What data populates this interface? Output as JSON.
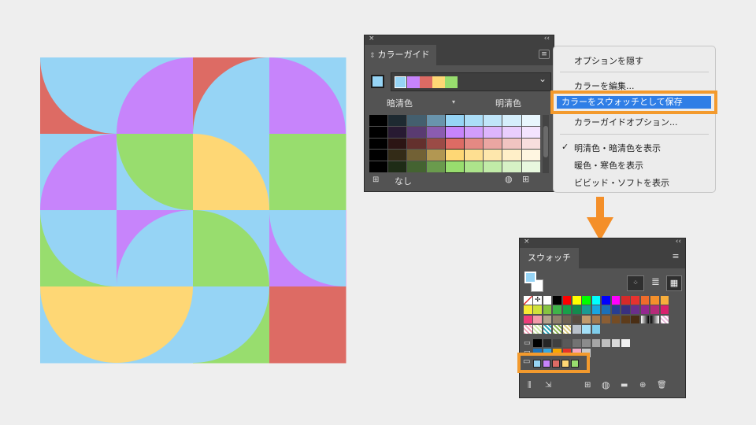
{
  "colors": {
    "red": "#dd6b64",
    "purple": "#c784fb",
    "blue": "#96d4f5",
    "green": "#98dd6e",
    "yellow": "#fed775",
    "orange": "#f48f29",
    "highlight_blue": "#2f7ee6"
  },
  "color_guide": {
    "title_close": "×",
    "title_collapse": "‹‹",
    "tab_label": "カラーガイド",
    "tab_arrows": "⇕",
    "menu_icon": "≡",
    "dropdown_arrow": "⌄",
    "darker_label": "暗清色",
    "lighter_label": "明清色",
    "center_arrow": "▾",
    "none_label": "なし",
    "group_color_icon": "grid-icon",
    "color_wheel_icon": "color-wheel-icon",
    "save_to_swatches_icon": "save-group-icon"
  },
  "menu": {
    "items": [
      "オプションを隠す",
      "カラーを編集...",
      "カラーをスウォッチとして保存",
      "カラーガイドオプション...",
      "明清色・暗清色を表示",
      "暖色・寒色を表示",
      "ビビッド・ソフトを表示"
    ],
    "checkmark": "✓"
  },
  "swatches": {
    "title_close": "×",
    "title_collapse": "‹‹",
    "tab_label": "スウォッチ",
    "menu_icon": "≡",
    "list_view_icon": "≣",
    "thumbnail_view_icon": "▦",
    "show_kinds_icon": "swatch-kinds-icon",
    "bottom_icons": [
      "library-icon",
      "import-icon",
      "color-group-icon",
      "color-wheel-icon",
      "folder-icon",
      "new-swatch-icon",
      "trash-icon"
    ],
    "new_group_colors": [
      "#96d4f5",
      "#c784fb",
      "#dd6b64",
      "#fed775",
      "#98dd6e"
    ]
  },
  "arrow_label": "↓"
}
